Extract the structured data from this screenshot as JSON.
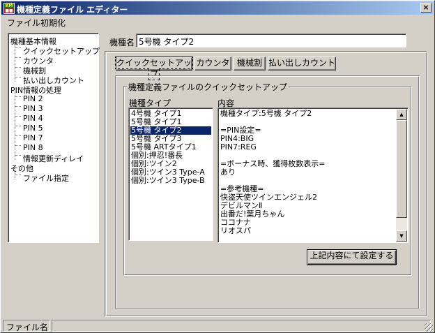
{
  "window": {
    "title": "機種定義ファイル エディター",
    "close_glyph": "×",
    "app_icon_top": "KM",
    "app_icon_bottom": "■■"
  },
  "menu": {
    "items": [
      "ファイル",
      "初期化"
    ]
  },
  "tree": {
    "items": [
      {
        "label": "機種基本情報",
        "level": 0
      },
      {
        "label": "クイックセットアップ",
        "level": 1
      },
      {
        "label": "カウンタ",
        "level": 1
      },
      {
        "label": "機械割",
        "level": 1
      },
      {
        "label": "払い出しカウント",
        "level": 1
      },
      {
        "label": "PIN情報の処理",
        "level": 0
      },
      {
        "label": "PIN 2",
        "level": 1
      },
      {
        "label": "PIN 3",
        "level": 1
      },
      {
        "label": "PIN 4",
        "level": 1
      },
      {
        "label": "PIN 5",
        "level": 1
      },
      {
        "label": "PIN 7",
        "level": 1
      },
      {
        "label": "PIN 8",
        "level": 1
      },
      {
        "label": "情報更新ディレイ",
        "level": 1
      },
      {
        "label": "その他",
        "level": 0
      },
      {
        "label": "ファイル指定",
        "level": 1
      }
    ]
  },
  "model_name": {
    "label": "機種名",
    "value": "5号機 タイプ2"
  },
  "tabs": [
    {
      "label": "クイックセットアップ",
      "active": true
    },
    {
      "label": "カウンタ",
      "active": false
    },
    {
      "label": "機械割",
      "active": false
    },
    {
      "label": "払い出しカウント",
      "active": false
    }
  ],
  "quick_setup": {
    "group_title": "機種定義ファイルのクイックセットアップ",
    "type_label": "機種タイプ",
    "content_label": "内容",
    "types": [
      "4号機 タイプ1",
      "5号機 タイプ1",
      "5号機 タイプ2",
      "5号機 タイプ3",
      "5号機 ARTタイプ1",
      "個別:押忍!番長",
      "個別:ツイン2",
      "個別:ツイン3 Type-A",
      "個別:ツイン3 Type-B"
    ],
    "selected_index": 2,
    "content_lines": [
      "機種タイプ:5号機 タイプ2",
      "",
      "=PIN設定=",
      "PIN4:BIG",
      "PIN7:REG",
      "",
      "=ボーナス時、獲得枚数表示=",
      "あり",
      "",
      "=参考機種=",
      "快盗天使ツインエンジェル2",
      "デビルマンⅡ",
      "出番だ!葉月ちゃん",
      "ココナナ",
      "リオスパ"
    ],
    "apply_button": "上記内容にて設定する",
    "scroll_up_glyph": "▲",
    "scroll_down_glyph": "▼"
  },
  "statusbar": {
    "panels": [
      "ファイル名",
      ""
    ]
  }
}
